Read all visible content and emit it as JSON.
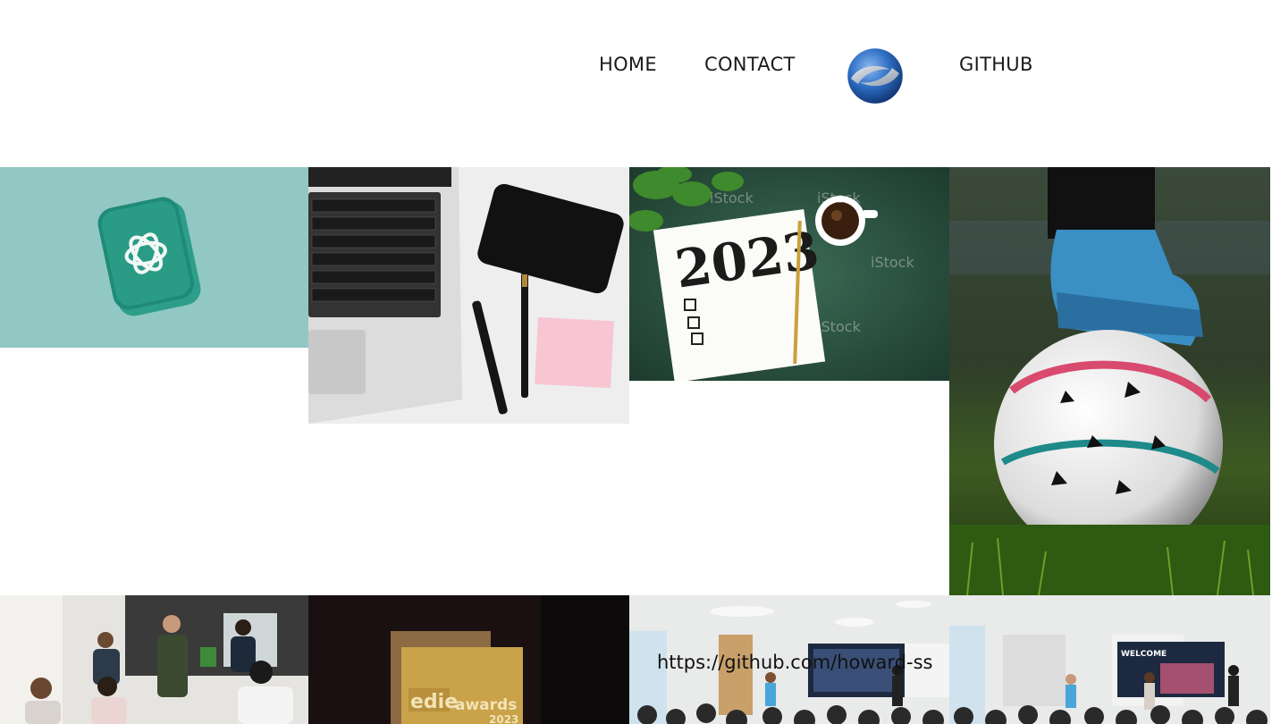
{
  "nav": {
    "home_label": "HOME",
    "contact_label": "CONTACT",
    "github_label": "GITHUB",
    "logo_icon": "swirl-globe-logo-icon"
  },
  "gallery": {
    "tiles": [
      {
        "name": "chatgpt-logo-tile",
        "icon": "openai-knot-icon",
        "bg": "#92c8c4"
      },
      {
        "name": "laptop-desk-tile"
      },
      {
        "name": "notebook-2023-tile",
        "text": "2023",
        "watermark": "iStock"
      },
      {
        "name": "football-boot-tile"
      },
      {
        "name": "meeting-people-tile"
      },
      {
        "name": "edie-award-tile",
        "text_main": "edie",
        "text_sub": "awards",
        "year": "2023"
      },
      {
        "name": "presentation-room-tile-1"
      },
      {
        "name": "presentation-room-tile-2",
        "screen_text": "WELCOME"
      }
    ]
  },
  "hover_link": {
    "text": "https://github.com/howard-ss"
  }
}
